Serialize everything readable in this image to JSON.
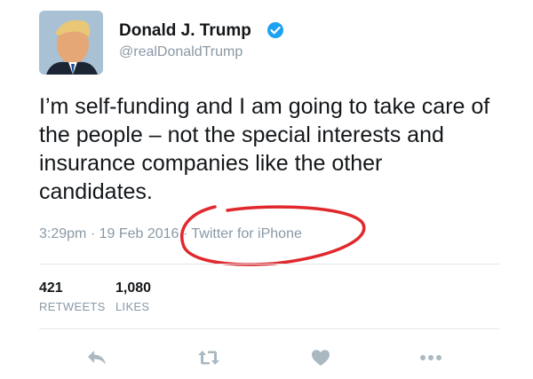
{
  "user": {
    "display_name": "Donald J. Trump",
    "handle": "@realDonaldTrump",
    "verified": true
  },
  "tweet": {
    "text": "I’m self-funding and I am going to take care of the people – not the special interests and insurance companies like the other candidates.",
    "timestamp": "3:29pm · 19 Feb 2016",
    "source_prefix": " · ",
    "source": "Twitter for iPhone"
  },
  "stats": {
    "retweets_count": "421",
    "retweets_label": "RETWEETS",
    "likes_count": "1,080",
    "likes_label": "LIKES"
  },
  "actions": [
    "reply-icon",
    "retweet-icon",
    "like-icon",
    "more-icon"
  ],
  "colors": {
    "text": "#14171a",
    "muted": "#8899a6",
    "verified": "#1da1f2",
    "annotation": "#e0282d",
    "icon": "#aab8c2"
  }
}
